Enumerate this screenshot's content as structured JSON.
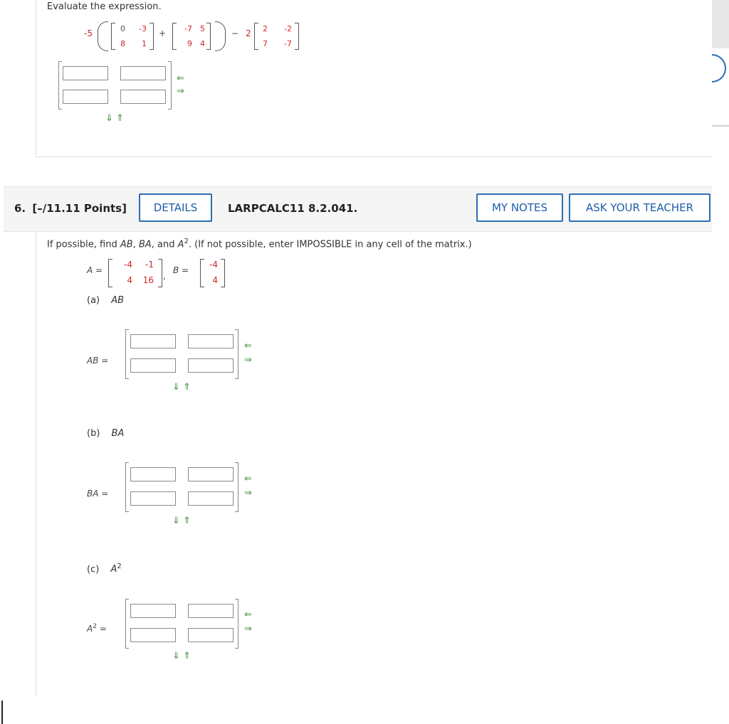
{
  "prev": {
    "instruction": "Evaluate the expression.",
    "scalar1": "-5",
    "m1": [
      "0",
      "-3",
      "8",
      "1"
    ],
    "plus": "+",
    "m2": [
      "-7",
      "5",
      "9",
      "4"
    ],
    "minus": "−",
    "scalar2": "2",
    "m3": [
      "2",
      "-2",
      "7",
      "-7"
    ]
  },
  "question": {
    "number": "6.",
    "points": "[–/11.11 Points]",
    "details_label": "DETAILS",
    "source": "LARPCALC11 8.2.041.",
    "my_notes_label": "MY NOTES",
    "ask_teacher_label": "ASK YOUR TEACHER"
  },
  "prompt": {
    "text_pre": "If possible, find ",
    "AB": "AB",
    "sep1": ", ",
    "BA": "BA",
    "sep2": ", and ",
    "A2": "A",
    "sup2": "2",
    "text_post": ". (If not possible, enter IMPOSSIBLE in any cell of the matrix.)"
  },
  "givens": {
    "A_label": "A =",
    "A_vals": [
      "-4",
      "-1",
      "4",
      "16"
    ],
    "comma": ",",
    "B_label": "B =",
    "B_vals": [
      "-4",
      "4"
    ]
  },
  "parts": {
    "a_label": "(a)",
    "a_name": "AB",
    "a_eq": "AB =",
    "b_label": "(b)",
    "b_name": "BA",
    "b_eq": "BA =",
    "c_label": "(c)",
    "c_name": "A",
    "c_sup": "2",
    "c_eq": "A",
    "c_eq_sup": "2",
    "c_eq_sign": "="
  },
  "icons": {
    "left_arrow": "⇐",
    "right_arrow": "⇒",
    "down_arrow": "⇓",
    "up_arrow": "⇑"
  },
  "colors": {
    "red_number": "#d0262a",
    "button_border": "#2c6db5",
    "arrow_green": "#3c8f3c"
  }
}
